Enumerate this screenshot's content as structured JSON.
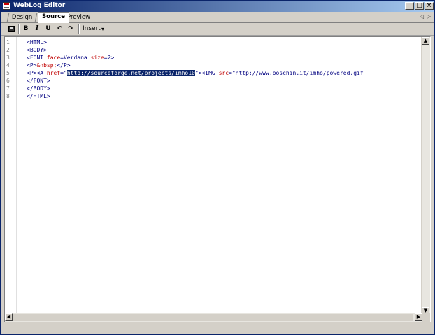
{
  "window": {
    "title": "WebLog Editor",
    "minimize_glyph": "_",
    "maximize_glyph": "□",
    "close_glyph": "×"
  },
  "tabs": [
    {
      "label": "Design",
      "active": false
    },
    {
      "label": "Source",
      "active": true
    },
    {
      "label": "Preview",
      "active": false
    }
  ],
  "tab_nav": {
    "left": "◁",
    "right": "▷"
  },
  "toolbar": {
    "bold": "B",
    "italic": "I",
    "underline": "U",
    "undo": "↶",
    "redo": "↷",
    "insert_label": "Insert",
    "insert_arrow": "▾"
  },
  "editor": {
    "line_numbers": [
      "1",
      "2",
      "3",
      "4",
      "5",
      "6",
      "7",
      "8"
    ],
    "lines": [
      {
        "t1": "<HTML>"
      },
      {
        "t1": "<BODY>"
      },
      {
        "t1": "<FONT ",
        "a1": "face",
        "t2": "=Verdana ",
        "a2": "size",
        "t3": "=2>"
      },
      {
        "t1": "<P>",
        "e1": "&nbsp;",
        "t2": "</P>"
      },
      {
        "t1": "<P><A ",
        "a1": "href",
        "t2": "=\"",
        "sel": "http://sourceforge.net/projects/imho10",
        "t3": "\"><IMG ",
        "a2": "src",
        "t4": "=\"http://www.boschin.it/imho/powered.gif"
      },
      {
        "t1": "</FONT>"
      },
      {
        "t1": "</BODY>"
      },
      {
        "t1": "</HTML>"
      }
    ]
  },
  "scrollbars": {
    "up": "▲",
    "down": "▼",
    "left": "◀",
    "right": "▶"
  }
}
